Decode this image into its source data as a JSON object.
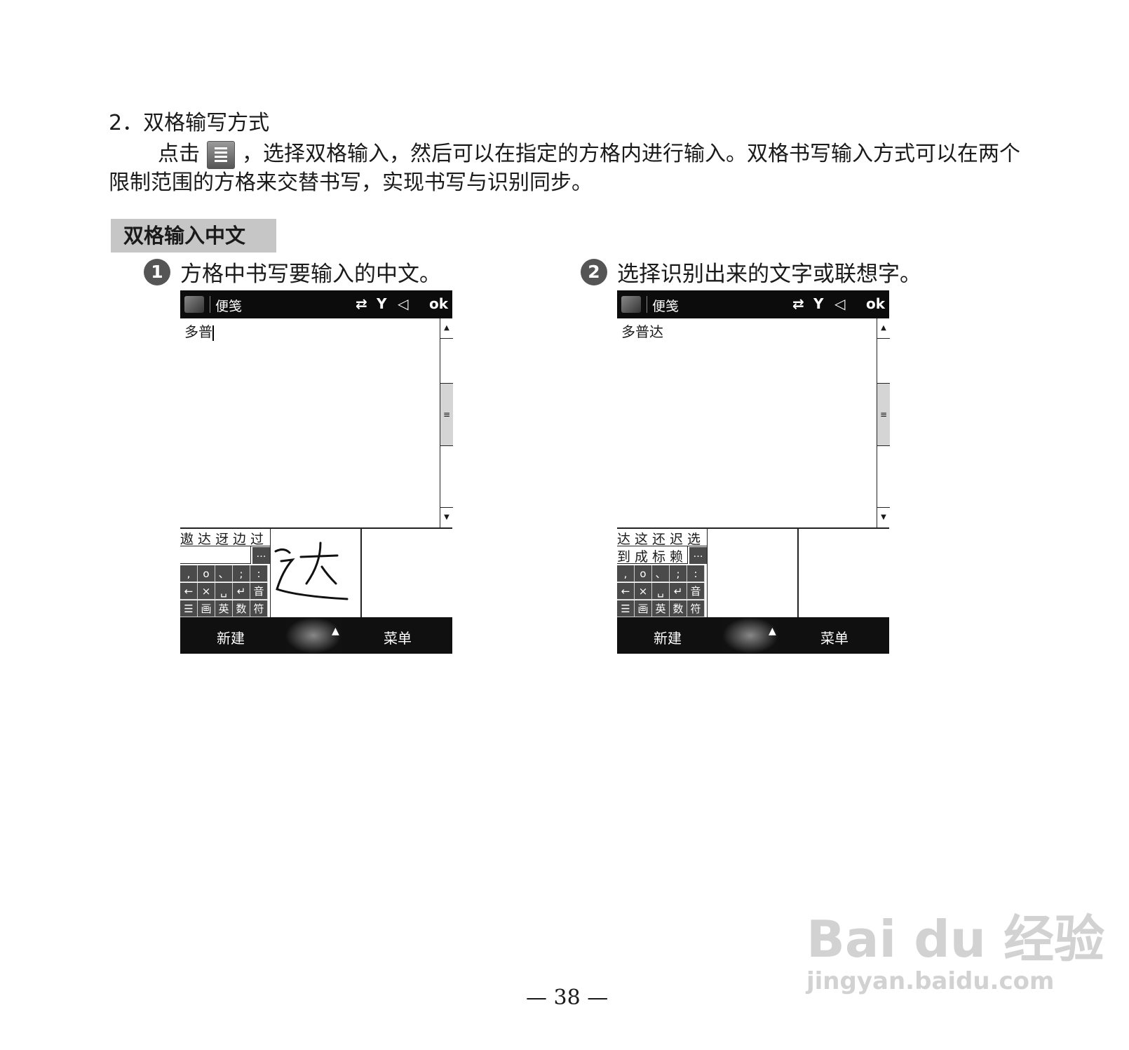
{
  "heading": "2．双格输写方式",
  "para_before_icon": "点击",
  "para_after_icon": "，选择双格输入，然后可以在指定的方格内进行输入。双格书写输入方式可以在两个限制范围的方格来交替书写，实现书写与识别同步。",
  "section_label": "双格输入中文",
  "steps": [
    {
      "num": "1",
      "text": "方格中书写要输入的中文。"
    },
    {
      "num": "2",
      "text": "选择识别出来的文字或联想字。"
    }
  ],
  "phone1": {
    "app_title": "便笺",
    "status_ok": "ok",
    "doc_text": "多普",
    "cand_row1": "遨达迓边过",
    "cand_row2": "",
    "keys_row1": [
      ",",
      "o",
      "、",
      ";",
      ":"
    ],
    "keys_row2": [
      "←",
      "×",
      "␣",
      "↵",
      "音"
    ],
    "keys_row3": [
      "☰",
      "画",
      "英",
      "数",
      "符"
    ],
    "handwriting": "达",
    "bottom_left": "新建",
    "bottom_right": "菜单"
  },
  "phone2": {
    "app_title": "便笺",
    "status_ok": "ok",
    "doc_text": "多普达",
    "cand_row1": "达这还迟选",
    "cand_row2": "到成标赖",
    "keys_row1": [
      ",",
      "o",
      "、",
      ";",
      ":"
    ],
    "keys_row2": [
      "←",
      "×",
      "␣",
      "↵",
      "音"
    ],
    "keys_row3": [
      "☰",
      "画",
      "英",
      "数",
      "符"
    ],
    "bottom_left": "新建",
    "bottom_right": "菜单"
  },
  "page_number": "— 38 —",
  "watermark": {
    "line1": "Bai du 经验",
    "line2": "jingyan.baidu.com"
  }
}
